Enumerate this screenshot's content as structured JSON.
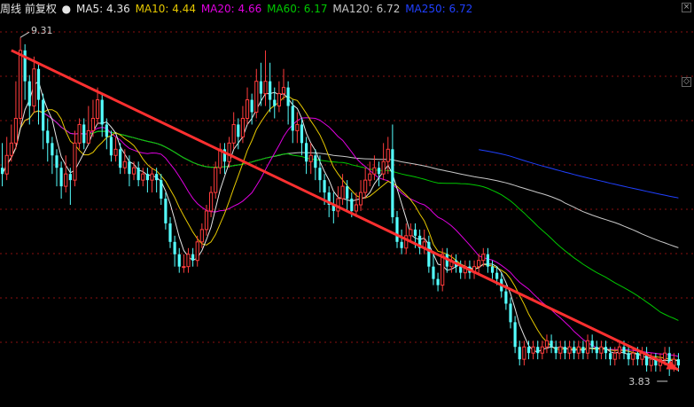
{
  "legend": {
    "title": "周线 前复权",
    "ma5": {
      "label": "MA5: 4.36",
      "color": "#e6e6e6"
    },
    "ma10": {
      "label": "MA10: 4.44",
      "color": "#e6c800"
    },
    "ma20": {
      "label": "MA20: 4.66",
      "color": "#e000e0"
    },
    "ma60": {
      "label": "MA60: 6.17",
      "color": "#00c800"
    },
    "ma120": {
      "label": "MA120: 6.72",
      "color": "#c8c8c8"
    },
    "ma250": {
      "label": "MA250: 6.72",
      "color": "#2040ff"
    }
  },
  "chart_data": {
    "type": "candlestick",
    "frequency": "weekly",
    "ylim": [
      3.6,
      9.6
    ],
    "high_label": "9.31",
    "low_label": "3.83",
    "colors": {
      "up": "#ff3c3c",
      "down": "#54ffff",
      "trend": "#ff3030"
    },
    "trendline": {
      "from": [
        2,
        9.1
      ],
      "to": [
        149,
        3.93
      ]
    },
    "candles": [
      [
        7.2,
        7.1,
        7.6,
        6.9
      ],
      [
        7.1,
        7.4,
        7.7,
        7.0
      ],
      [
        7.4,
        7.6,
        7.9,
        7.3
      ],
      [
        7.6,
        8.0,
        8.6,
        7.5
      ],
      [
        8.0,
        9.1,
        9.31,
        7.9
      ],
      [
        9.1,
        8.6,
        9.2,
        8.3
      ],
      [
        8.6,
        8.2,
        8.7,
        7.9
      ],
      [
        8.2,
        8.8,
        9.0,
        8.1
      ],
      [
        8.8,
        8.3,
        8.9,
        7.9
      ],
      [
        8.3,
        7.8,
        8.4,
        7.5
      ],
      [
        7.8,
        7.6,
        8.0,
        7.3
      ],
      [
        7.6,
        7.4,
        7.7,
        7.1
      ],
      [
        7.4,
        7.2,
        7.5,
        6.9
      ],
      [
        7.2,
        6.9,
        7.3,
        6.7
      ],
      [
        6.9,
        7.1,
        7.4,
        6.8
      ],
      [
        7.1,
        7.0,
        7.2,
        6.6
      ],
      [
        7.0,
        7.6,
        7.8,
        6.9
      ],
      [
        7.6,
        7.9,
        8.0,
        7.5
      ],
      [
        7.9,
        7.6,
        8.0,
        7.5
      ],
      [
        7.6,
        7.8,
        8.2,
        7.6
      ],
      [
        7.8,
        8.0,
        8.3,
        7.7
      ],
      [
        8.0,
        8.3,
        8.5,
        7.9
      ],
      [
        8.3,
        7.9,
        8.4,
        7.7
      ],
      [
        7.9,
        7.7,
        8.0,
        7.5
      ],
      [
        7.7,
        7.4,
        7.8,
        7.3
      ],
      [
        7.4,
        7.5,
        7.7,
        7.3
      ],
      [
        7.5,
        7.2,
        7.6,
        7.1
      ],
      [
        7.2,
        7.3,
        7.5,
        7.1
      ],
      [
        7.3,
        7.1,
        7.4,
        6.9
      ],
      [
        7.1,
        7.2,
        7.3,
        7.0
      ],
      [
        7.2,
        7.0,
        7.3,
        6.9
      ],
      [
        7.0,
        7.1,
        7.2,
        6.9
      ],
      [
        7.1,
        7.0,
        7.2,
        6.8
      ],
      [
        7.0,
        7.1,
        7.2,
        6.8
      ],
      [
        7.1,
        7.0,
        7.2,
        6.8
      ],
      [
        7.0,
        6.7,
        7.1,
        6.6
      ],
      [
        6.7,
        6.3,
        6.8,
        6.2
      ],
      [
        6.3,
        6.0,
        6.4,
        5.9
      ],
      [
        6.0,
        5.8,
        6.1,
        5.6
      ],
      [
        5.8,
        5.6,
        5.9,
        5.5
      ],
      [
        5.6,
        5.6,
        5.8,
        5.5
      ],
      [
        5.6,
        5.8,
        5.9,
        5.5
      ],
      [
        5.8,
        5.7,
        5.9,
        5.6
      ],
      [
        5.7,
        6.0,
        6.1,
        5.6
      ],
      [
        6.0,
        6.2,
        6.3,
        5.9
      ],
      [
        6.2,
        6.5,
        6.6,
        6.1
      ],
      [
        6.5,
        6.8,
        6.9,
        6.4
      ],
      [
        6.8,
        7.2,
        7.3,
        6.7
      ],
      [
        7.2,
        7.5,
        7.6,
        7.1
      ],
      [
        7.5,
        7.3,
        7.6,
        7.1
      ],
      [
        7.3,
        7.6,
        7.7,
        7.2
      ],
      [
        7.6,
        7.9,
        8.1,
        7.5
      ],
      [
        7.9,
        7.7,
        8.0,
        7.5
      ],
      [
        7.7,
        8.0,
        8.2,
        7.6
      ],
      [
        8.0,
        8.3,
        8.5,
        7.9
      ],
      [
        8.3,
        8.1,
        8.4,
        7.9
      ],
      [
        8.1,
        8.6,
        8.8,
        8.0
      ],
      [
        8.6,
        8.4,
        8.9,
        8.2
      ],
      [
        8.4,
        8.6,
        9.1,
        8.2
      ],
      [
        8.6,
        8.3,
        8.9,
        8.1
      ],
      [
        8.3,
        8.2,
        8.5,
        8.0
      ],
      [
        8.2,
        8.4,
        8.6,
        8.1
      ],
      [
        8.4,
        8.5,
        8.8,
        8.3
      ],
      [
        8.5,
        8.2,
        8.6,
        7.9
      ],
      [
        8.2,
        7.8,
        8.3,
        7.6
      ],
      [
        7.8,
        7.9,
        8.1,
        7.6
      ],
      [
        7.9,
        7.6,
        8.0,
        7.4
      ],
      [
        7.6,
        7.3,
        7.7,
        7.1
      ],
      [
        7.3,
        7.4,
        7.6,
        7.1
      ],
      [
        7.4,
        7.2,
        7.5,
        7.0
      ],
      [
        7.2,
        7.0,
        7.4,
        6.8
      ],
      [
        7.0,
        6.8,
        7.1,
        6.6
      ],
      [
        6.8,
        6.6,
        6.9,
        6.4
      ],
      [
        6.6,
        6.5,
        6.8,
        6.3
      ],
      [
        6.5,
        6.7,
        6.9,
        6.4
      ],
      [
        6.7,
        6.9,
        7.1,
        6.6
      ],
      [
        6.9,
        6.7,
        7.0,
        6.5
      ],
      [
        6.7,
        6.5,
        6.8,
        6.4
      ],
      [
        6.5,
        6.6,
        6.8,
        6.4
      ],
      [
        6.6,
        6.8,
        7.0,
        6.5
      ],
      [
        6.8,
        7.0,
        7.2,
        6.7
      ],
      [
        7.0,
        7.1,
        7.3,
        6.9
      ],
      [
        7.1,
        7.2,
        7.4,
        7.0
      ],
      [
        7.2,
        7.1,
        7.3,
        6.9
      ],
      [
        7.1,
        7.3,
        7.6,
        7.0
      ],
      [
        7.3,
        7.5,
        7.7,
        7.1
      ],
      [
        7.5,
        6.4,
        7.9,
        6.3
      ],
      [
        6.4,
        6.0,
        6.5,
        5.9
      ],
      [
        6.0,
        5.9,
        6.2,
        5.8
      ],
      [
        5.9,
        6.1,
        6.3,
        5.8
      ],
      [
        6.1,
        6.2,
        6.3,
        6.0
      ],
      [
        6.2,
        6.1,
        6.3,
        5.9
      ],
      [
        6.1,
        5.9,
        6.2,
        5.8
      ],
      [
        5.9,
        6.0,
        6.2,
        5.8
      ],
      [
        6.0,
        5.6,
        6.1,
        5.5
      ],
      [
        5.6,
        5.4,
        5.8,
        5.3
      ],
      [
        5.4,
        5.3,
        5.5,
        5.2
      ],
      [
        5.3,
        5.8,
        5.9,
        5.2
      ],
      [
        5.8,
        5.6,
        5.9,
        5.5
      ],
      [
        5.6,
        5.7,
        5.8,
        5.5
      ],
      [
        5.7,
        5.6,
        5.8,
        5.5
      ],
      [
        5.6,
        5.5,
        5.7,
        5.4
      ],
      [
        5.5,
        5.6,
        5.7,
        5.4
      ],
      [
        5.6,
        5.5,
        5.7,
        5.4
      ],
      [
        5.5,
        5.6,
        5.7,
        5.4
      ],
      [
        5.6,
        5.7,
        5.8,
        5.5
      ],
      [
        5.7,
        5.8,
        5.9,
        5.6
      ],
      [
        5.8,
        5.6,
        5.9,
        5.5
      ],
      [
        5.6,
        5.5,
        5.7,
        5.4
      ],
      [
        5.5,
        5.4,
        5.6,
        5.3
      ],
      [
        5.4,
        5.2,
        5.5,
        5.1
      ],
      [
        5.2,
        5.0,
        5.3,
        4.9
      ],
      [
        5.0,
        4.7,
        5.1,
        4.6
      ],
      [
        4.7,
        4.3,
        4.8,
        4.2
      ],
      [
        4.3,
        4.1,
        4.4,
        4.0
      ],
      [
        4.1,
        4.3,
        4.4,
        4.0
      ],
      [
        4.3,
        4.2,
        4.4,
        4.1
      ],
      [
        4.2,
        4.3,
        4.4,
        4.1
      ],
      [
        4.3,
        4.2,
        4.4,
        4.1
      ],
      [
        4.2,
        4.3,
        4.4,
        4.1
      ],
      [
        4.3,
        4.4,
        4.5,
        4.2
      ],
      [
        4.4,
        4.3,
        4.5,
        4.2
      ],
      [
        4.3,
        4.2,
        4.4,
        4.1
      ],
      [
        4.2,
        4.3,
        4.4,
        4.1
      ],
      [
        4.3,
        4.2,
        4.4,
        4.1
      ],
      [
        4.2,
        4.3,
        4.4,
        4.1
      ],
      [
        4.3,
        4.2,
        4.4,
        4.1
      ],
      [
        4.2,
        4.3,
        4.4,
        4.1
      ],
      [
        4.3,
        4.2,
        4.4,
        4.1
      ],
      [
        4.2,
        4.4,
        4.5,
        4.1
      ],
      [
        4.4,
        4.3,
        4.5,
        4.2
      ],
      [
        4.3,
        4.2,
        4.4,
        4.1
      ],
      [
        4.2,
        4.3,
        4.4,
        4.1
      ],
      [
        4.3,
        4.2,
        4.4,
        4.1
      ],
      [
        4.2,
        4.1,
        4.3,
        4.0
      ],
      [
        4.1,
        4.2,
        4.3,
        4.0
      ],
      [
        4.2,
        4.3,
        4.4,
        4.1
      ],
      [
        4.3,
        4.2,
        4.4,
        4.1
      ],
      [
        4.2,
        4.1,
        4.3,
        4.0
      ],
      [
        4.1,
        4.2,
        4.3,
        4.0
      ],
      [
        4.2,
        4.1,
        4.3,
        4.0
      ],
      [
        4.1,
        4.2,
        4.3,
        4.0
      ],
      [
        4.2,
        4.0,
        4.3,
        3.9
      ],
      [
        4.0,
        4.1,
        4.2,
        3.9
      ],
      [
        4.1,
        4.0,
        4.2,
        3.9
      ],
      [
        4.0,
        4.1,
        4.2,
        3.9
      ],
      [
        4.1,
        4.2,
        4.3,
        4.0
      ],
      [
        4.2,
        4.0,
        4.3,
        3.83
      ],
      [
        4.0,
        4.1,
        4.2,
        3.9
      ],
      [
        4.1,
        4.0,
        4.2,
        3.9
      ]
    ]
  }
}
